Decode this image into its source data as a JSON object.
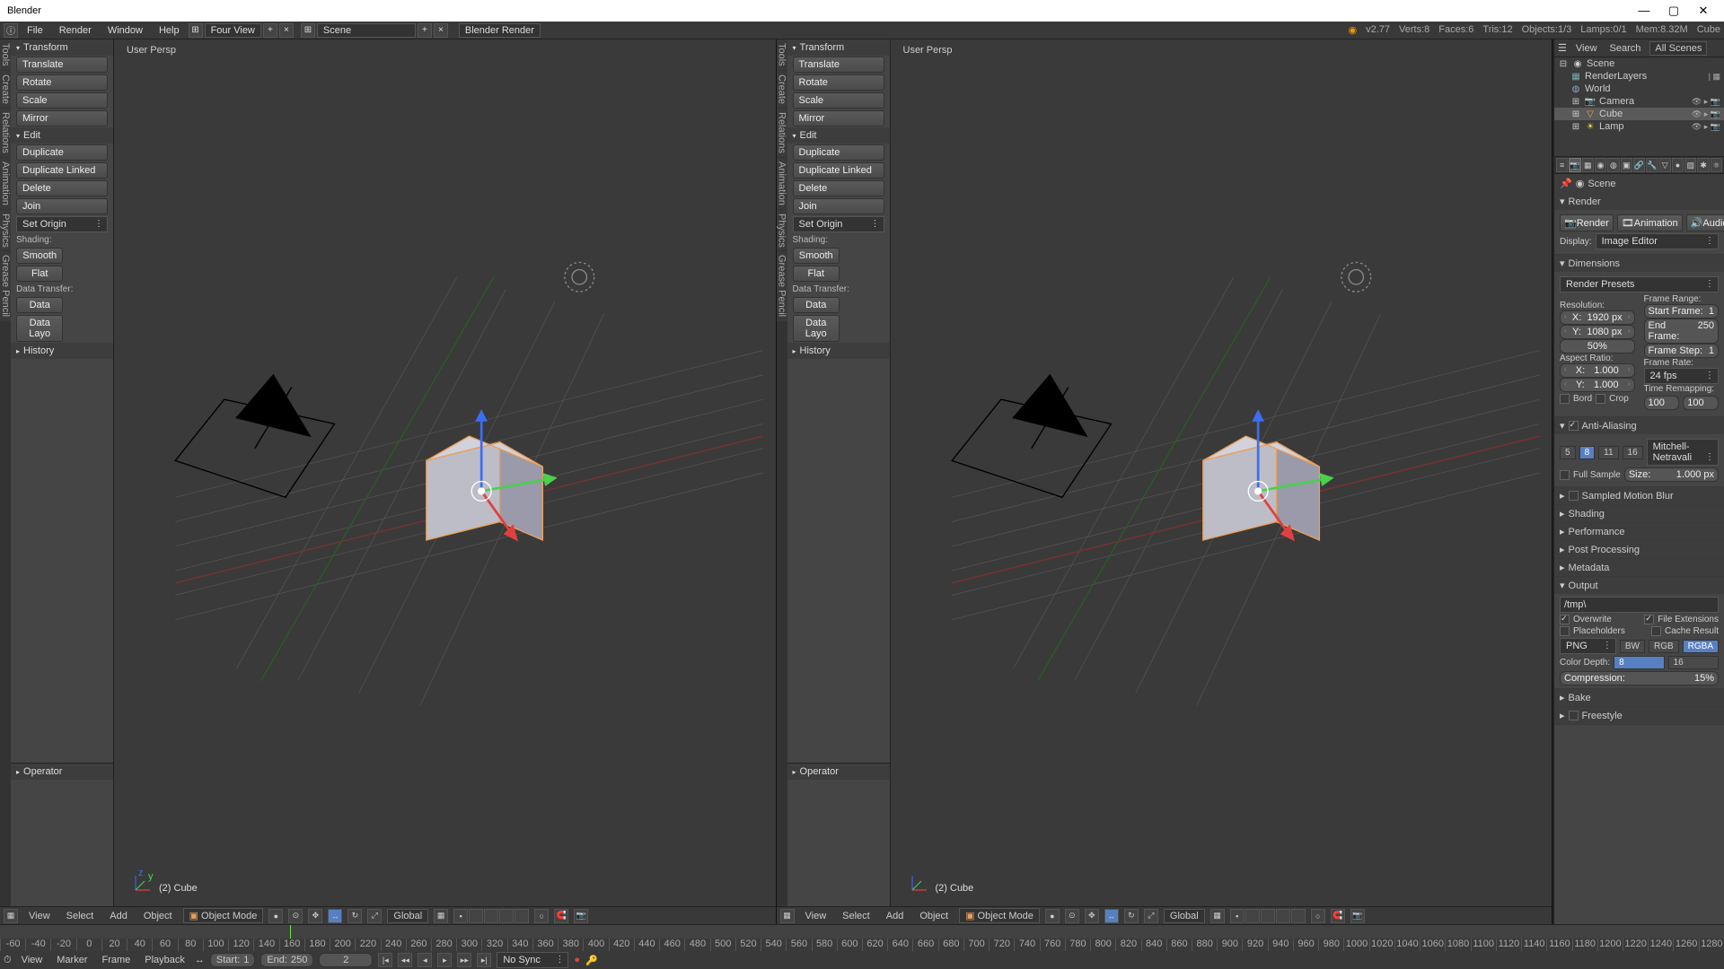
{
  "title": "Blender",
  "menubar": {
    "file": "File",
    "render": "Render",
    "window": "Window",
    "help": "Help",
    "layout": "Four View",
    "scene": "Scene",
    "renderer": "Blender Render"
  },
  "stats": {
    "version": "v2.77",
    "verts": "Verts:8",
    "faces": "Faces:6",
    "tris": "Tris:12",
    "objects": "Objects:1/3",
    "lamps": "Lamps:0/1",
    "mem": "Mem:8.32M",
    "obj": "Cube"
  },
  "toolpanel": {
    "transform": "Transform",
    "translate": "Translate",
    "rotate": "Rotate",
    "scale": "Scale",
    "mirror": "Mirror",
    "edit": "Edit",
    "duplicate": "Duplicate",
    "dup_linked": "Duplicate Linked",
    "delete": "Delete",
    "join": "Join",
    "set_origin": "Set Origin",
    "shading": "Shading:",
    "smooth": "Smooth",
    "flat": "Flat",
    "data_transfer": "Data Transfer:",
    "data": "Data",
    "data_layo": "Data Layo",
    "history": "History",
    "operator": "Operator"
  },
  "tabs": [
    "Tools",
    "Create",
    "Relations",
    "Animation",
    "Physics",
    "Grease Pencil"
  ],
  "viewport": {
    "persp": "User Persp",
    "object": "(2) Cube"
  },
  "viewheader": {
    "view": "View",
    "select": "Select",
    "add": "Add",
    "object": "Object",
    "mode": "Object Mode",
    "global": "Global"
  },
  "outliner": {
    "view": "View",
    "search": "Search",
    "all": "All Scenes",
    "scene": "Scene",
    "renderlayers": "RenderLayers",
    "world": "World",
    "camera": "Camera",
    "cube": "Cube",
    "lamp": "Lamp"
  },
  "props": {
    "scene_crumb": "Scene",
    "render": "Render",
    "render_btn": "Render",
    "animation_btn": "Animation",
    "audio_btn": "Audio",
    "display": "Display:",
    "image_editor": "Image Editor",
    "dimensions": "Dimensions",
    "render_presets": "Render Presets",
    "resolution": "Resolution:",
    "x": "X:",
    "y": "Y:",
    "res_x": "1920 px",
    "res_y": "1080 px",
    "res_pct": "50%",
    "aspect": "Aspect Ratio:",
    "aspect_x": "1.000",
    "aspect_y": "1.000",
    "bord": "Bord",
    "crop": "Crop",
    "frame_range": "Frame Range:",
    "start_frame": "Start Frame:",
    "start_val": "1",
    "end_frame": "End Frame:",
    "end_val": "250",
    "frame_step": "Frame Step:",
    "step_val": "1",
    "frame_rate": "Frame Rate:",
    "fps": "24 fps",
    "time_remap": "Time Remapping:",
    "remap_a": "100",
    "remap_b": "100",
    "aa": "Anti-Aliasing",
    "aa5": "5",
    "aa8": "8",
    "aa11": "11",
    "aa16": "16",
    "mitchell": "Mitchell-Netravali",
    "full_sample": "Full Sample",
    "size": "Size:",
    "size_val": "1.000 px",
    "sampled_blur": "Sampled Motion Blur",
    "shading": "Shading",
    "performance": "Performance",
    "post": "Post Processing",
    "metadata": "Metadata",
    "output": "Output",
    "output_path": "/tmp\\",
    "overwrite": "Overwrite",
    "file_ext": "File Extensions",
    "placeholders": "Placeholders",
    "cache": "Cache Result",
    "png": "PNG",
    "bw": "BW",
    "rgb": "RGB",
    "rgba": "RGBA",
    "color_depth": "Color Depth:",
    "cd8": "8",
    "cd16": "16",
    "compression": "Compression:",
    "comp_val": "15%",
    "bake": "Bake",
    "freestyle": "Freestyle"
  },
  "timeline": {
    "view": "View",
    "marker": "Marker",
    "frame": "Frame",
    "playback": "Playback",
    "start": "Start:",
    "start_v": "1",
    "end": "End:",
    "end_v": "250",
    "cur": "2",
    "nosync": "No Sync",
    "ticks": [
      "-60",
      "-40",
      "-20",
      "0",
      "20",
      "40",
      "60",
      "80",
      "100",
      "120",
      "140",
      "160",
      "180",
      "200",
      "220",
      "240",
      "260",
      "280",
      "300",
      "320",
      "340",
      "360",
      "380",
      "400",
      "420",
      "440",
      "460",
      "480",
      "500",
      "520",
      "540",
      "560",
      "580",
      "600",
      "620",
      "640",
      "660",
      "680",
      "700",
      "720",
      "740",
      "760",
      "780",
      "800",
      "820",
      "840",
      "860",
      "880",
      "900",
      "920",
      "940",
      "960",
      "980",
      "1000",
      "1020",
      "1040",
      "1060",
      "1080",
      "1100",
      "1120",
      "1140",
      "1160",
      "1180",
      "1200",
      "1220",
      "1240",
      "1260",
      "1280"
    ]
  }
}
